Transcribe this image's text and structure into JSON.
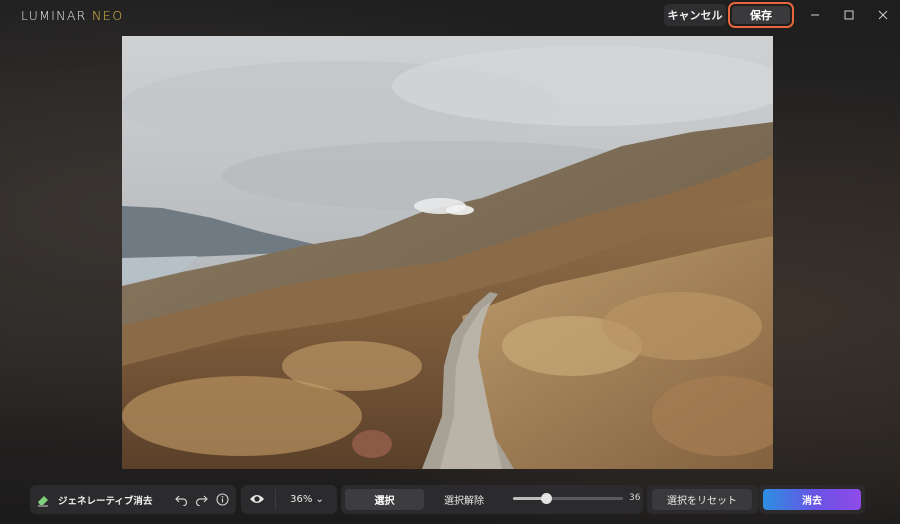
{
  "app": {
    "logo_main": "LUMINAR ",
    "logo_accent": "NEO"
  },
  "titlebar": {
    "cancel_label": "キャンセル",
    "save_label": "保存",
    "minimize_glyph": "—",
    "maximize_glyph": "☐",
    "close_glyph": "✕"
  },
  "toolbar": {
    "tool_label": "ジェネレーティブ消去",
    "zoom_label": "36% ⌄",
    "select_label": "選択",
    "deselect_label": "選択解除",
    "brush_size": 36,
    "brush_size_label": "36",
    "brush_fraction": 0.3,
    "reset_label": "選択をリセット",
    "erase_label": "消去"
  },
  "colors": {
    "save_highlight": "#e5673b",
    "erase_gradient_start": "#2d8fe0",
    "erase_gradient_end": "#8f4be8",
    "logo_accent": "#e8c64a"
  },
  "icons": {
    "tool": "eraser-icon",
    "undo": "undo-icon",
    "redo": "redo-icon",
    "info": "info-icon",
    "visibility": "eye-icon"
  }
}
